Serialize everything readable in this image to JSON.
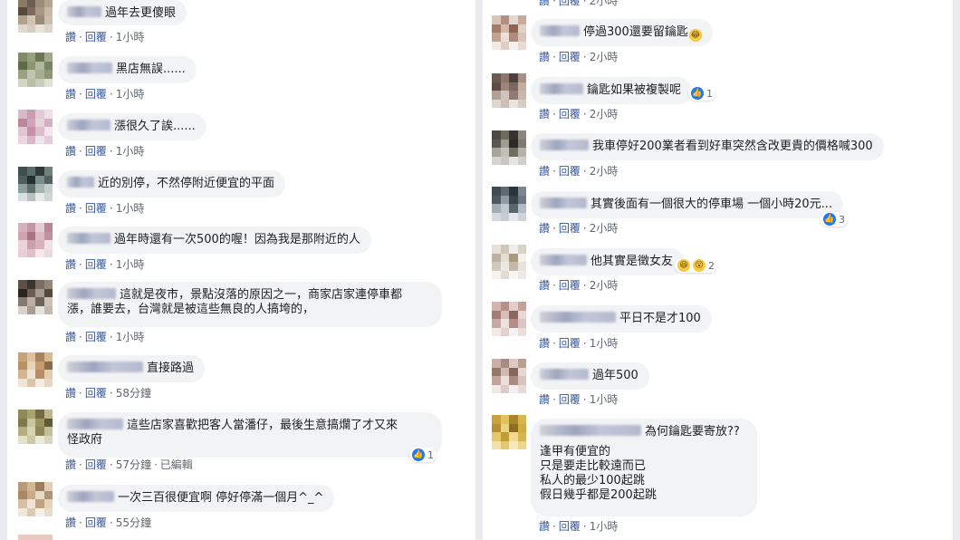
{
  "labels": {
    "like": "讚",
    "reply": "回覆",
    "dot": "·",
    "edited": "已編輯"
  },
  "left_comments": [
    {
      "text": "過年去更傻眼",
      "time": "1小時"
    },
    {
      "text": "黑店無誤......",
      "time": "1小時"
    },
    {
      "text": "漲很久了誒......",
      "time": "1小時"
    },
    {
      "text": "近的別停，不然停附近便宜的平面",
      "time": "1小時"
    },
    {
      "text": "過年時還有一次500的喔！因為我是那附近的人",
      "time": "1小時"
    },
    {
      "text_line1": "這就是夜市，景點沒落的原因之一，商家店家連停車都",
      "text_line2": "漲，誰要去，台灣就是被這些無良的人搞垮的，",
      "time": "1小時"
    },
    {
      "text": "直接路過",
      "time": "58分鐘"
    },
    {
      "text_line1": "這些店家喜歡把客人當潘仔，最後生意搞爛了才又來",
      "text_line2": "怪政府",
      "time": "57分鐘",
      "reaction_count": "1"
    },
    {
      "text": "一次三百很便宜啊 停好停滿一個月^_^",
      "time": "55分鐘"
    }
  ],
  "right_comments": [
    {
      "text": "停過300還要留鑰匙",
      "emoji": "😂",
      "time": "2小時"
    },
    {
      "text": "鑰匙如果被複製呢",
      "time": "2小時",
      "reaction_count": "1"
    },
    {
      "text": "我車停好200業者看到好車突然含改更貴的價格喊300",
      "time": "2小時"
    },
    {
      "text": "其實後面有一個很大的停車場 一個小時20元...",
      "time": "2小時",
      "reaction_count": "3"
    },
    {
      "text": "他其實是徵女友",
      "time": "2小時",
      "reaction_count": "2"
    },
    {
      "text": "平日不是才100",
      "time": "1小時"
    },
    {
      "text": "過年500",
      "time": "1小時"
    },
    {
      "text_line1": "為何鑰匙要寄放??",
      "text_line2": "逢甲有便宜的",
      "text_line3": "只是要走比較遠而已",
      "text_line4": "私人的最少100起跳",
      "text_line5": "假日幾乎都是200起跳",
      "time": "1小時"
    }
  ],
  "colors": {
    "link": "#385898",
    "bubble": "#f2f3f5",
    "like_blue": "#2078f4"
  }
}
